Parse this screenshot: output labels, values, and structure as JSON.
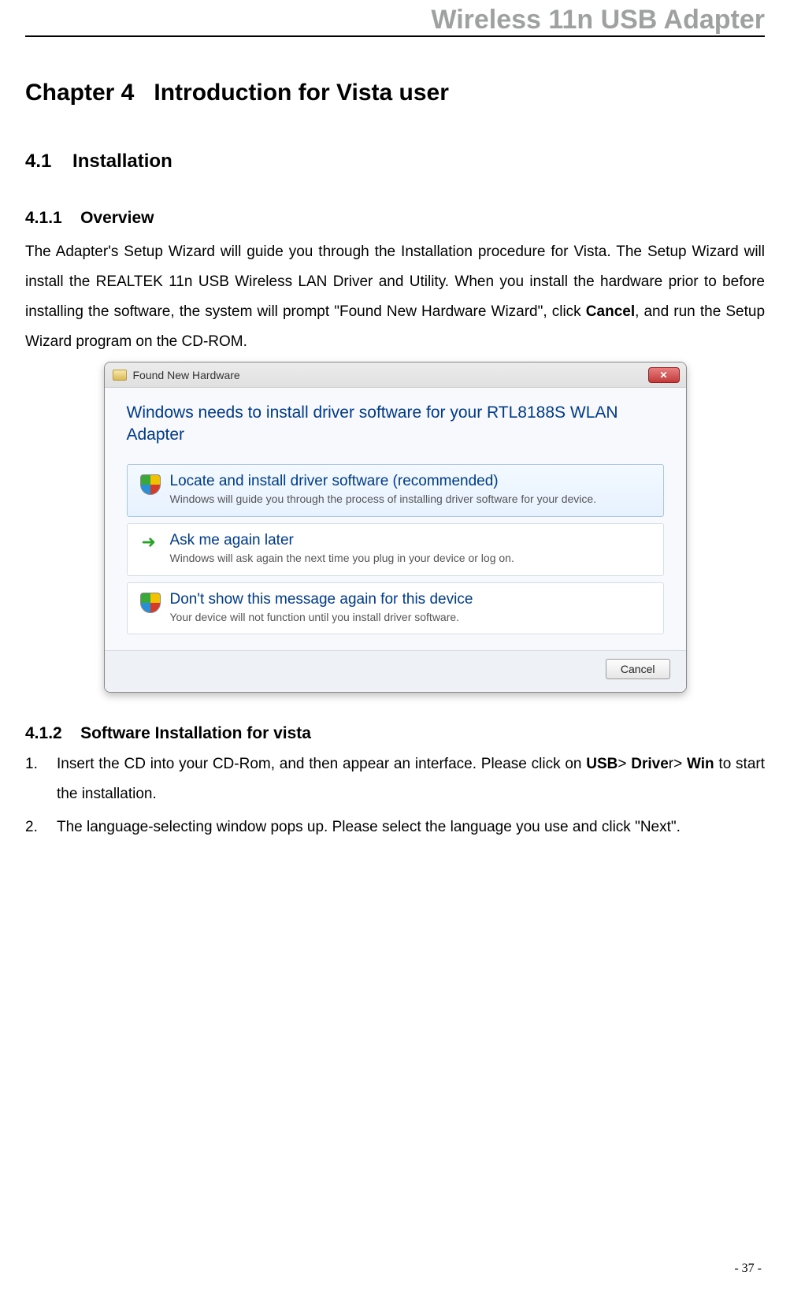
{
  "header": {
    "title": "Wireless 11n USB Adapter"
  },
  "chapter": {
    "number": "Chapter 4",
    "title": "Introduction for Vista user"
  },
  "section": {
    "number": "4.1",
    "title": "Installation"
  },
  "subsection1": {
    "number": "4.1.1",
    "title": "Overview",
    "para_pre": "The Adapter's Setup Wizard will guide you through the Installation procedure for Vista. The Setup Wizard will install the REALTEK 11n USB Wireless LAN Driver and Utility. When you install the hardware prior to before installing the software, the system will prompt \"Found New Hardware Wizard\", click ",
    "para_bold": "Cancel",
    "para_post": ", and run the Setup Wizard program on the CD-ROM."
  },
  "vista_dialog": {
    "titlebar": "Found New Hardware",
    "heading": "Windows needs to install driver software for your RTL8188S WLAN Adapter",
    "options": [
      {
        "title": "Locate and install driver software (recommended)",
        "desc": "Windows will guide you through the process of installing driver software for your device.",
        "icon": "shield"
      },
      {
        "title": "Ask me again later",
        "desc": "Windows will ask again the next time you plug in your device or log on.",
        "icon": "arrow"
      },
      {
        "title": "Don't show this message again for this device",
        "desc": "Your device will not function until you install driver software.",
        "icon": "shield"
      }
    ],
    "cancel_label": "Cancel"
  },
  "subsection2": {
    "number": "4.1.2",
    "title": "Software Installation for vista",
    "items": [
      {
        "num": "1.",
        "pre": "Insert the CD into your CD-Rom, and then appear an interface. Please click on ",
        "b1": "USB",
        "mid1": "> ",
        "b2": "Drive",
        "mid2": "r> ",
        "b3": "Win",
        "post": " to start the installation."
      },
      {
        "num": "2.",
        "text": "The language-selecting window pops up. Please select the language you use and click \"Next\"."
      }
    ]
  },
  "page_number": "- 37 -"
}
